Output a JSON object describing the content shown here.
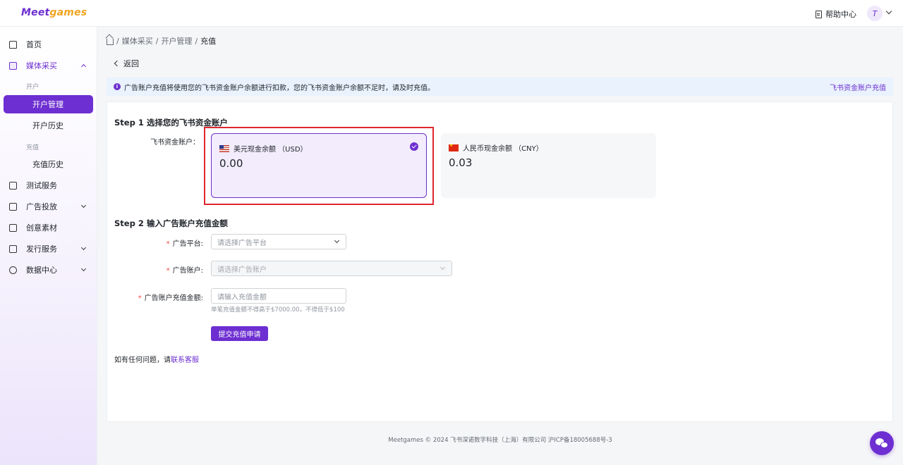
{
  "brand": {
    "logo_part1": "Meet",
    "logo_part2": "games"
  },
  "header": {
    "help_label": "帮助中心",
    "avatar_initial": "T"
  },
  "sidebar": {
    "items": [
      {
        "label": "首页"
      },
      {
        "label": "媒体采买"
      },
      {
        "label": "测试服务"
      },
      {
        "label": "广告投放"
      },
      {
        "label": "创意素材"
      },
      {
        "label": "发行服务"
      },
      {
        "label": "数据中心"
      }
    ],
    "media_groups": {
      "open_group": "开户",
      "open_mgmt": "开户管理",
      "open_history": "开户历史",
      "recharge_group": "充值",
      "recharge_history": "充值历史"
    }
  },
  "breadcrumb": {
    "sep": "/",
    "items": [
      "媒体采买",
      "开户管理",
      "充值"
    ]
  },
  "back_label": "返回",
  "notice": {
    "message": "广告账户充值将使用您的飞书资金账户余额进行扣款，您的飞书资金账户余额不足时，请及时充值。",
    "link": "飞书资金账户充值"
  },
  "step1": {
    "title": "Step 1 选择您的飞书资金账户",
    "label": "飞书资金账户：",
    "accounts": [
      {
        "name": "美元现金余额 （USD）",
        "amount": "0.00",
        "selected": true
      },
      {
        "name": "人民币现金余额 （CNY）",
        "amount": "0.03",
        "selected": false
      }
    ]
  },
  "step2": {
    "title": "Step 2 输入广告账户充值金额",
    "required_mark": "*",
    "platform_label": "广告平台:",
    "platform_placeholder": "请选择广告平台",
    "account_label": "广告账户:",
    "account_placeholder": "请选择广告账户",
    "amount_label": "广告账户充值金额:",
    "amount_placeholder": "请输入充值金额",
    "amount_hint": "单笔充值金额不得高于$7000.00，不得低于$100",
    "submit_label": "提交充值申请"
  },
  "contact": {
    "prefix": "如有任何问题，请",
    "link": "联系客服"
  },
  "footer": {
    "text": "Meetgames © 2024 飞书深诺数字科技（上海）有限公司 沪ICP备18005688号-3"
  },
  "colors": {
    "accent": "#6d2fd1",
    "highlight_box": "#e0262d",
    "notice_bg": "#e9f2fd"
  }
}
